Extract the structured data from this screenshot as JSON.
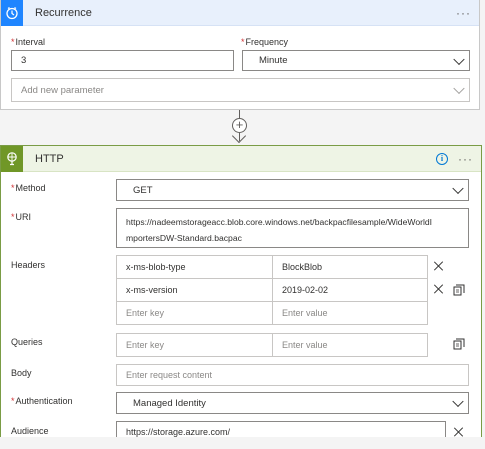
{
  "recurrence": {
    "title": "Recurrence",
    "more": "···",
    "interval_label": "Interval",
    "interval_value": "3",
    "frequency_label": "Frequency",
    "frequency_value": "Minute",
    "add_param_placeholder": "Add new parameter"
  },
  "connector": {
    "plus": "+"
  },
  "http": {
    "title": "HTTP",
    "info": "i",
    "more": "···",
    "method_label": "Method",
    "method_value": "GET",
    "uri_label": "URI",
    "uri_line1": "https://nadeemstorageacc.blob.core.windows.net/backpacfilesample/WideWorldI",
    "uri_line2": "mportersDW-Standard.bacpac",
    "headers_label": "Headers",
    "headers": [
      {
        "key": "x-ms-blob-type",
        "value": "BlockBlob"
      },
      {
        "key": "x-ms-version",
        "value": "2019-02-02"
      }
    ],
    "key_placeholder": "Enter key",
    "value_placeholder": "Enter value",
    "queries_label": "Queries",
    "body_label": "Body",
    "body_placeholder": "Enter request content",
    "auth_label": "Authentication",
    "auth_value": "Managed Identity",
    "audience_label": "Audience",
    "audience_value": "https://storage.azure.com/"
  },
  "colors": {
    "recurrence_accent": "#1f85ff",
    "http_accent": "#709727",
    "required": "#d13438",
    "info": "#0078d4"
  }
}
